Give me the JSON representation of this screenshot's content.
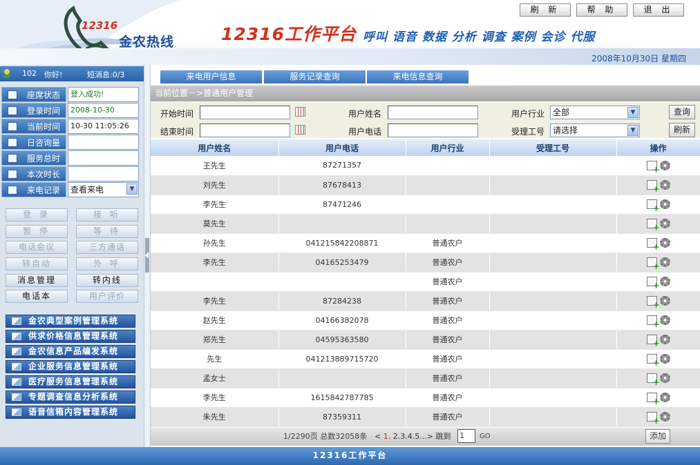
{
  "header": {
    "logo_number": "12316",
    "logo_text": "金农热线",
    "platform_title": "12316工作平台",
    "platform_subtitle": "呼叫 语音 数据 分析 调查 案例 会诊 代服",
    "date": "2008年10月30日  星期四",
    "buttons": {
      "refresh": "刷 新",
      "help": "帮 助",
      "exit": "退 出"
    }
  },
  "user": {
    "id": "102",
    "greeting": "你好!",
    "messages": "短消息:0/3"
  },
  "status_rows": [
    {
      "label": "座席状态",
      "value": "登入成功!"
    },
    {
      "label": "登录时间",
      "value": "2008-10-30"
    },
    {
      "label": "当前时间",
      "value": "10-30 11:05:26"
    },
    {
      "label": "日咨询量",
      "value": ""
    },
    {
      "label": "服务总时",
      "value": ""
    },
    {
      "label": "本次时长",
      "value": ""
    }
  ],
  "call_record": {
    "label": "来电记录",
    "value": "查看来电"
  },
  "phone_buttons": [
    {
      "label": "登 录",
      "enabled": false
    },
    {
      "label": "接 听",
      "enabled": false
    },
    {
      "label": "暂 停",
      "enabled": false
    },
    {
      "label": "等 待",
      "enabled": false
    },
    {
      "label": "电话会议",
      "enabled": false
    },
    {
      "label": "三方通话",
      "enabled": false
    },
    {
      "label": "转自动",
      "enabled": false
    },
    {
      "label": "外 呼",
      "enabled": false
    },
    {
      "label": "消息管理",
      "enabled": true
    },
    {
      "label": "转内线",
      "enabled": true
    },
    {
      "label": "电话本",
      "enabled": true
    },
    {
      "label": "用户评价",
      "enabled": false
    }
  ],
  "systems": [
    "金农典型案例管理系统",
    "供求价格信息管理系统",
    "金农信息产品编发系统",
    "企业服务信息管理系统",
    "医疗服务信息管理系统",
    "专题调查信息分析系统",
    "语音信箱内容管理系统"
  ],
  "tabs": [
    "来电用户信息",
    "服务记录查询",
    "来电信息查询"
  ],
  "breadcrumb": "当前位置－>普通用户管理",
  "search": {
    "start_time_label": "开始时间",
    "end_time_label": "结束时间",
    "user_name_label": "用户姓名",
    "user_phone_label": "用户电话",
    "industry_label": "用户行业",
    "industry_value": "全部",
    "agent_label": "受理工号",
    "agent_value": "请选择",
    "query_button": "查询",
    "refresh_button": "刷新"
  },
  "table": {
    "headers": [
      "用户姓名",
      "用户电话",
      "用户行业",
      "受理工号",
      "操作"
    ],
    "rows": [
      [
        "王先生",
        "87271357",
        "",
        ""
      ],
      [
        "刘先生",
        "87678413",
        "",
        ""
      ],
      [
        "李先生",
        "87471246",
        "",
        ""
      ],
      [
        "莫先生",
        "",
        "",
        ""
      ],
      [
        "孙先生",
        "041215842208871",
        "普通农户",
        ""
      ],
      [
        "李先生",
        "04165253479",
        "普通农户",
        ""
      ],
      [
        "",
        "",
        "普通农户",
        ""
      ],
      [
        "李先生",
        "87284238",
        "普通农户",
        ""
      ],
      [
        "赵先生",
        "04166382078",
        "普通农户",
        ""
      ],
      [
        "郑先生",
        "04595363580",
        "普通农户",
        ""
      ],
      [
        "先生",
        "041213889715720",
        "普通农户",
        ""
      ],
      [
        "孟女士",
        "",
        "普通农户",
        ""
      ],
      [
        "李先生",
        "1615842787785",
        "普通农户",
        ""
      ],
      [
        "朱先生",
        "87359311",
        "普通农户",
        ""
      ]
    ]
  },
  "pager": {
    "summary": "1/2290页  总数32058条",
    "prev": "<",
    "current_page": "1.",
    "pages": "2.3.4.5...>",
    "jump_label": "跳到",
    "jump_value": "1",
    "go": "GO",
    "add_button": "添加"
  },
  "footer": "12316工作平台",
  "colors": {
    "accent": "#2f68b0",
    "title_red": "#d4301c",
    "success": "#1a7a1a"
  }
}
